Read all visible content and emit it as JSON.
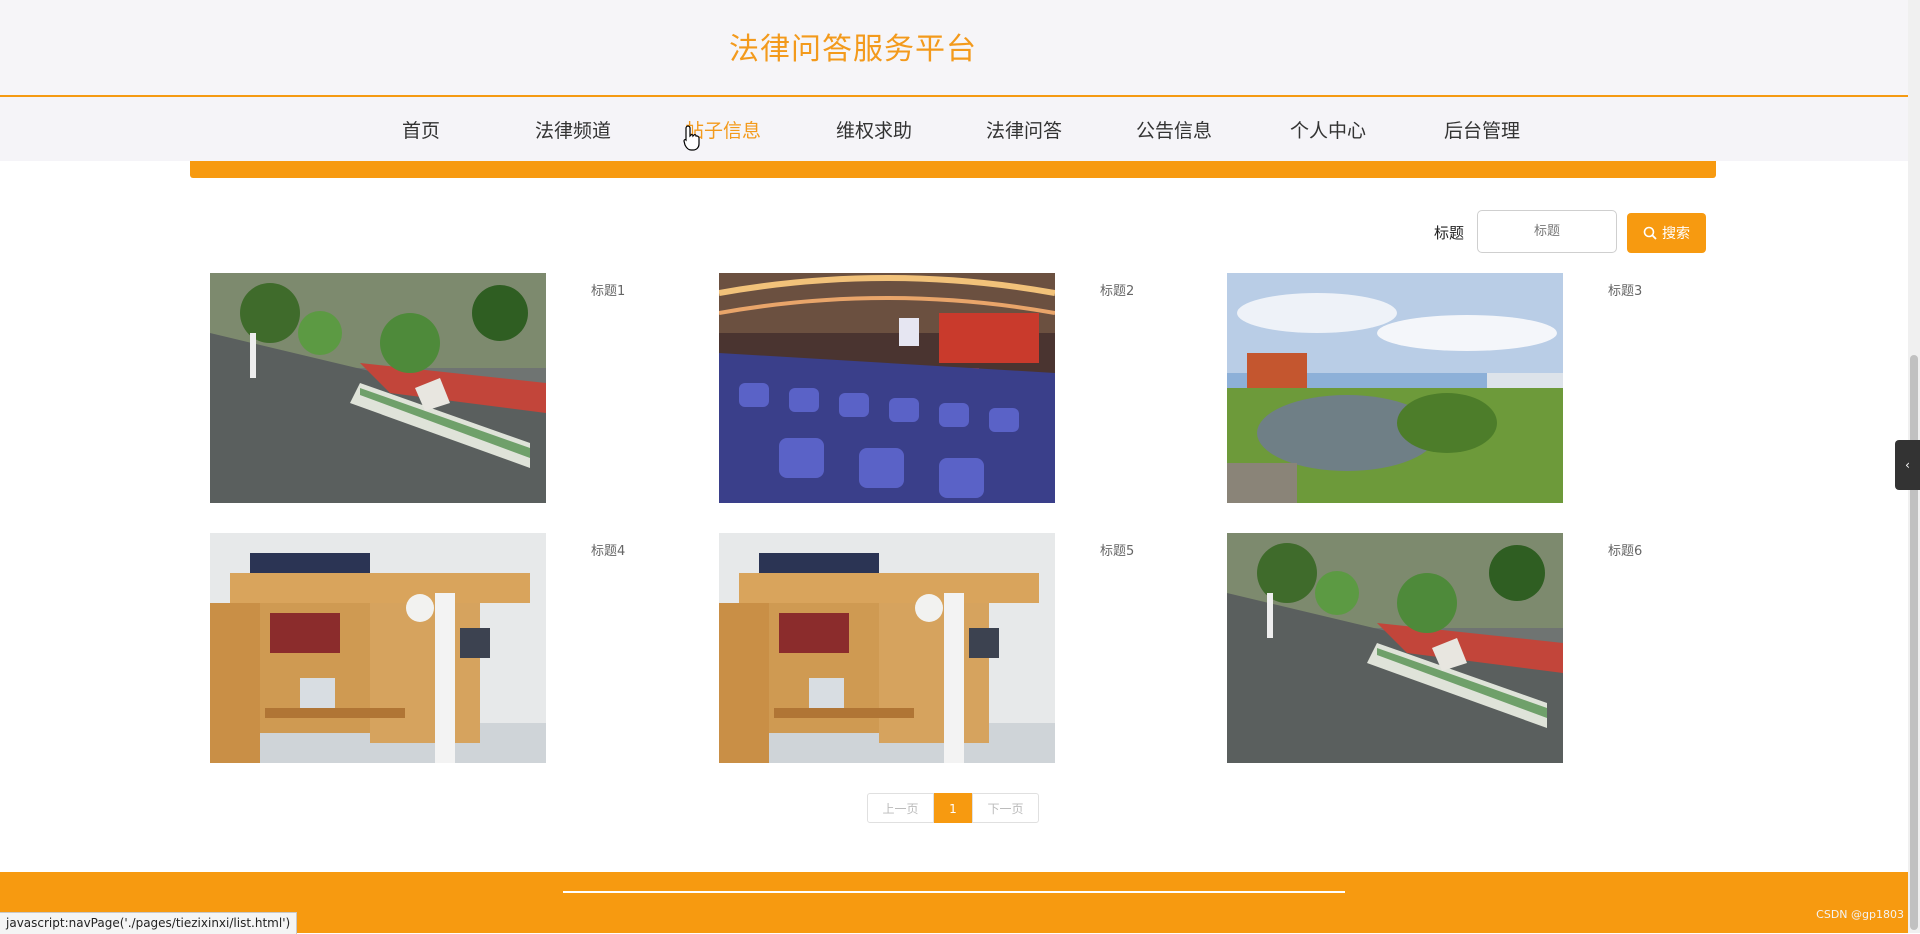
{
  "header": {
    "site_title": "法律问答服务平台"
  },
  "nav": {
    "items": [
      {
        "label": "首页"
      },
      {
        "label": "法律频道"
      },
      {
        "label": "帖子信息",
        "active": true
      },
      {
        "label": "维权求助"
      },
      {
        "label": "法律问答"
      },
      {
        "label": "公告信息"
      },
      {
        "label": "个人中心"
      },
      {
        "label": "后台管理"
      }
    ]
  },
  "search": {
    "label": "标题",
    "placeholder": "标题",
    "button_label": "搜索",
    "icon": "search-icon"
  },
  "posts": [
    {
      "title": "标题1",
      "image": "campus-garden"
    },
    {
      "title": "标题2",
      "image": "lecture-hall"
    },
    {
      "title": "标题3",
      "image": "campus-lake"
    },
    {
      "title": "标题4",
      "image": "dorm-room"
    },
    {
      "title": "标题5",
      "image": "dorm-room"
    },
    {
      "title": "标题6",
      "image": "campus-garden"
    }
  ],
  "pagination": {
    "prev_label": "上一页",
    "current_page": "1",
    "next_label": "下一页"
  },
  "status_bar": {
    "url": "javascript:navPage('./pages/tiezixinxi/list.html')"
  },
  "watermark": "CSDN @gp1803",
  "colors": {
    "accent": "#f79a10",
    "title": "#f39a1c"
  }
}
